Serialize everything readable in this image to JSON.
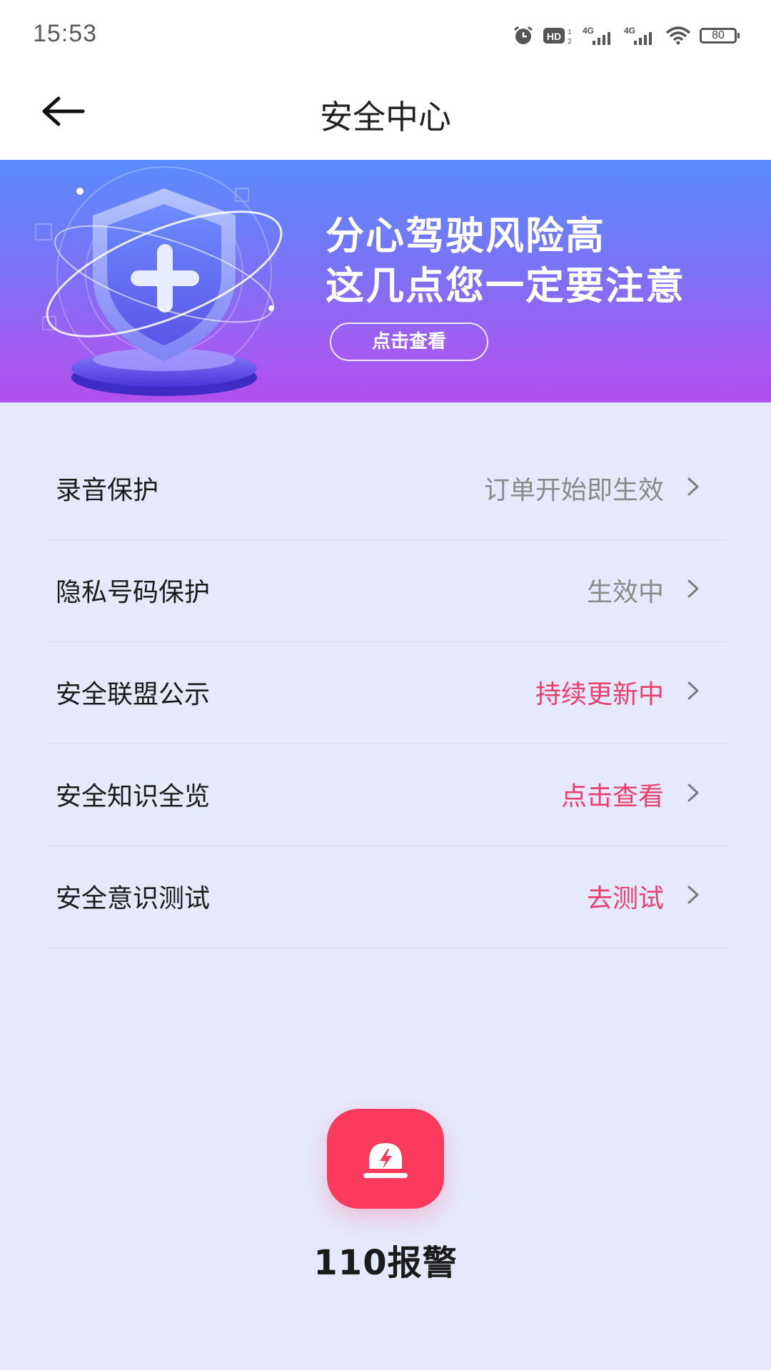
{
  "status_bar": {
    "time": "15:53",
    "battery": "80",
    "icons": [
      "alarm-icon",
      "hd-icon",
      "signal-4g-icon",
      "signal-4g-icon",
      "wifi-icon",
      "battery-icon"
    ]
  },
  "header": {
    "title": "安全中心",
    "back_icon": "arrow-left-icon"
  },
  "banner": {
    "line1": "分心驾驶风险高",
    "line2": "这几点您一定要注意",
    "button_label": "点击查看",
    "art_icon": "shield-plus-icon"
  },
  "menu": {
    "items": [
      {
        "label": "录音保护",
        "status": "订单开始即生效",
        "status_color": "#8a8a8a"
      },
      {
        "label": "隐私号码保护",
        "status": "生效中",
        "status_color": "#8a8a8a"
      },
      {
        "label": "安全联盟公示",
        "status": "持续更新中",
        "status_color": "#ea3f6d"
      },
      {
        "label": "安全知识全览",
        "status": "点击查看",
        "status_color": "#ea3f6d"
      },
      {
        "label": "安全意识测试",
        "status": "去测试",
        "status_color": "#ea3f6d"
      }
    ]
  },
  "alarm": {
    "label": "110报警",
    "icon": "alarm-siren-icon",
    "color": "#fb3a5e"
  },
  "colors": {
    "background": "#e6e8fb",
    "accent": "#ea3f6d"
  }
}
